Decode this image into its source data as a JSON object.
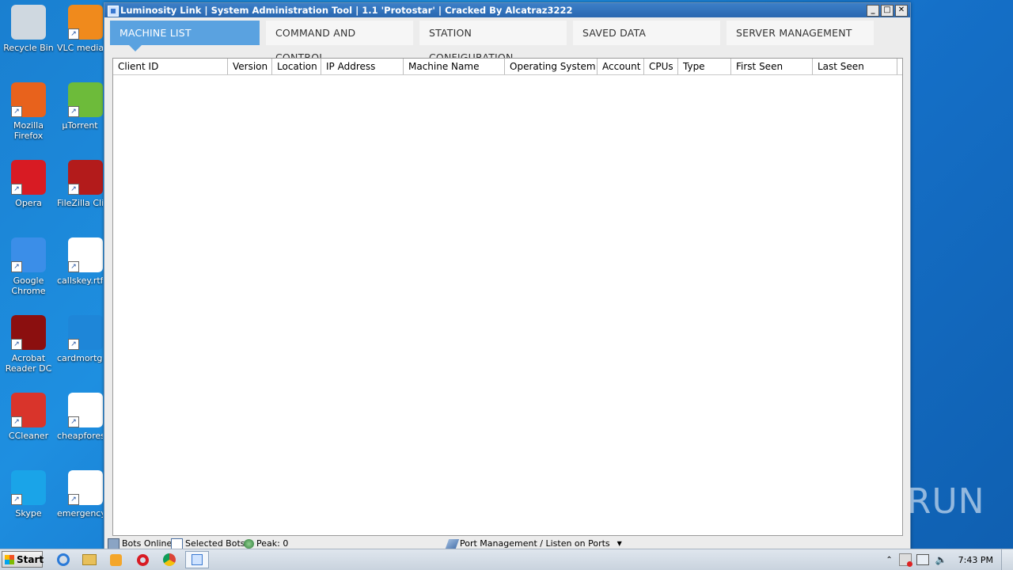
{
  "desktop": {
    "icons": [
      {
        "label": "Recycle Bin",
        "icon": "recycle-bin-icon",
        "color": "#cfd8e0"
      },
      {
        "label": "VLC media player",
        "icon": "vlc-icon",
        "color": "#f08a1c"
      },
      {
        "label": "Mozilla Firefox",
        "icon": "firefox-icon",
        "color": "#e8621c"
      },
      {
        "label": "µTorrent",
        "icon": "utorrent-icon",
        "color": "#6dbb3a"
      },
      {
        "label": "Opera",
        "icon": "opera-icon",
        "color": "#d81b23"
      },
      {
        "label": "FileZilla Client",
        "icon": "filezilla-icon",
        "color": "#b31b1b"
      },
      {
        "label": "Google Chrome",
        "icon": "chrome-icon",
        "color": "#3b8ee8"
      },
      {
        "label": "callskey.rtf",
        "icon": "word-document-icon",
        "color": "#ffffff"
      },
      {
        "label": "Acrobat Reader DC",
        "icon": "acrobat-icon",
        "color": "#8b0f0f"
      },
      {
        "label": "cardmortgage",
        "icon": "blank-file-icon",
        "color": "#1e86d8"
      },
      {
        "label": "CCleaner",
        "icon": "ccleaner-icon",
        "color": "#d9342b"
      },
      {
        "label": "cheapforest",
        "icon": "word-document-icon",
        "color": "#ffffff"
      },
      {
        "label": "Skype",
        "icon": "skype-icon",
        "color": "#1aa4e8"
      },
      {
        "label": "emergency",
        "icon": "word-document-icon",
        "color": "#ffffff"
      }
    ]
  },
  "window": {
    "title": "Luminosity Link | System Administration Tool | 1.1 'Protostar' | Cracked By Alcatraz3222",
    "controls": {
      "minimize": "_",
      "maximize": "□",
      "close": "✕"
    }
  },
  "tabs": [
    {
      "label": "MACHINE LIST",
      "active": true
    },
    {
      "label": "COMMAND AND CONTROL",
      "active": false
    },
    {
      "label": "STATION CONFIGURATION",
      "active": false
    },
    {
      "label": "SAVED DATA",
      "active": false
    },
    {
      "label": "SERVER MANAGEMENT",
      "active": false
    }
  ],
  "machine_list": {
    "columns": [
      "Client ID",
      "Version",
      "Location",
      "IP Address",
      "Machine Name",
      "Operating System",
      "Account",
      "CPUs",
      "Type",
      "First Seen",
      "Last Seen"
    ],
    "rows": []
  },
  "statusbar": {
    "bots_online": "Bots Online:",
    "selected_bots": "Selected Bots:",
    "peak": "Peak: 0",
    "port_management": "Port Management / Listen on Ports"
  },
  "taskbar": {
    "start_label": "Start",
    "apps": [
      "internet-explorer-icon",
      "explorer-folder-icon",
      "media-player-icon",
      "opera-icon",
      "chrome-icon",
      "luminosity-link-icon"
    ],
    "clock": "7:43 PM"
  },
  "watermark": "ANY RUN",
  "colors": {
    "tab_active": "#5aa2e0",
    "titlebar": "#2a67b0",
    "desktop": "#1a7fd0"
  }
}
